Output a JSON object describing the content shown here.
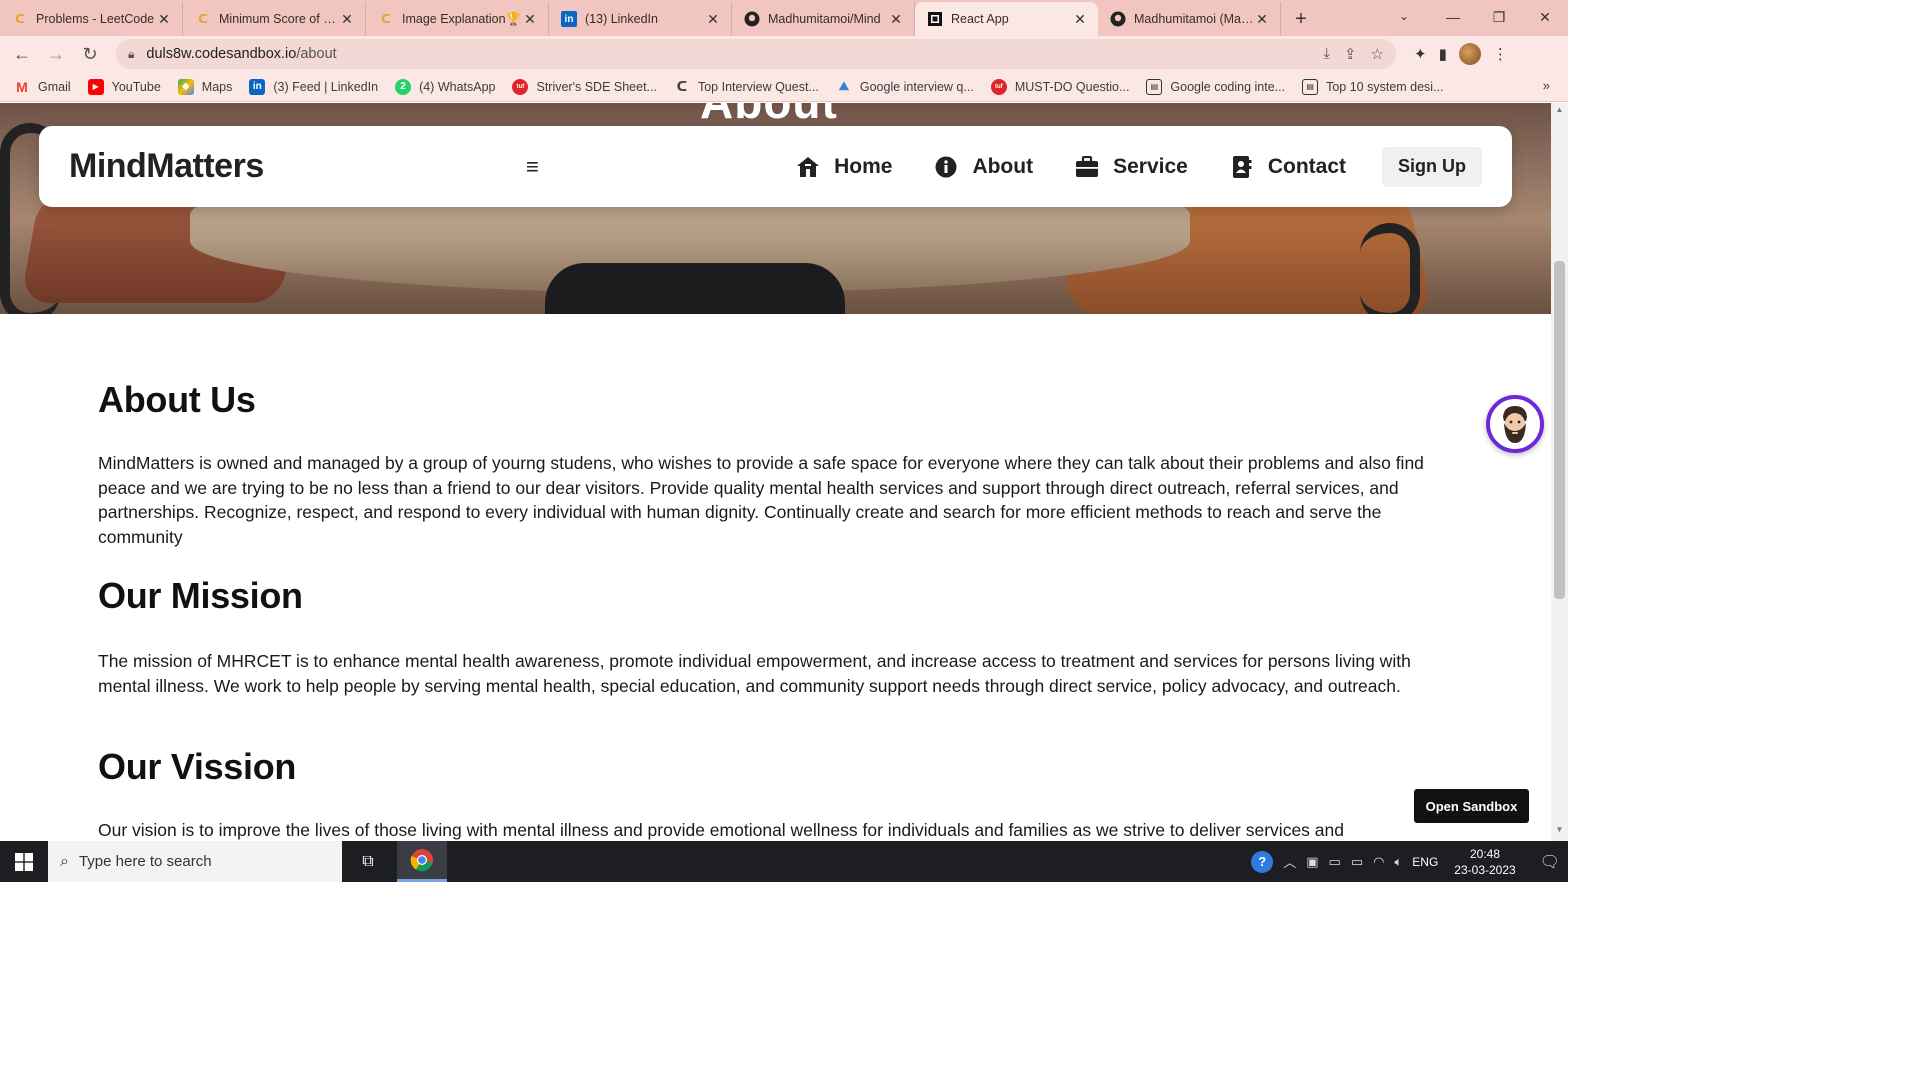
{
  "browser": {
    "tabs": [
      {
        "title": "Problems - LeetCode",
        "icon": "leetcode-icon",
        "active": false
      },
      {
        "title": "Minimum Score of a P",
        "icon": "leetcode-icon",
        "active": false
      },
      {
        "title": "Image Explanation🏆",
        "icon": "leetcode-icon",
        "active": false
      },
      {
        "title": "(13) LinkedIn",
        "icon": "linkedin-icon",
        "active": false
      },
      {
        "title": "Madhumitamoi/Mind",
        "icon": "github-icon",
        "active": false
      },
      {
        "title": "React App",
        "icon": "codesandbox-icon",
        "active": true
      },
      {
        "title": "Madhumitamoi (Madh",
        "icon": "github-icon",
        "active": false
      }
    ],
    "address": {
      "host": "duls8w.codesandbox.io",
      "path": "/about"
    },
    "bookmarks": [
      {
        "label": "Gmail",
        "icon": "gmail-icon",
        "color": "#ea4335"
      },
      {
        "label": "YouTube",
        "icon": "youtube-icon",
        "color": "#ff0000"
      },
      {
        "label": "Maps",
        "icon": "maps-icon",
        "color": "#34a853"
      },
      {
        "label": "(3) Feed | LinkedIn",
        "icon": "linkedin-icon",
        "color": "#0a66c2"
      },
      {
        "label": "(4) WhatsApp",
        "icon": "whatsapp-icon",
        "color": "#25d366"
      },
      {
        "label": "Striver's SDE Sheet...",
        "icon": "tuf-icon",
        "color": "#e0242c"
      },
      {
        "label": "Top Interview Quest...",
        "icon": "leetcode-icon",
        "color": "#444444"
      },
      {
        "label": "Google interview q...",
        "icon": "geeks-icon",
        "color": "#3b7dd8"
      },
      {
        "label": "MUST-DO Questio...",
        "icon": "tuf-icon",
        "color": "#e0242c"
      },
      {
        "label": "Google coding inte...",
        "icon": "page-icon",
        "color": "#333333"
      },
      {
        "label": "Top 10 system desi...",
        "icon": "page-icon",
        "color": "#333333"
      }
    ]
  },
  "site": {
    "hero_title": "About",
    "brand": "MindMatters",
    "nav": {
      "home": "Home",
      "about": "About",
      "service": "Service",
      "contact": "Contact",
      "signup": "Sign Up"
    },
    "sections": {
      "about_title": "About Us",
      "about_text": "MindMatters is owned and managed by a group of yourng studens, who wishes to provide a safe space for everyone where they can talk about their problems and also find peace and we are trying to be no less than a friend to our dear visitors. Provide quality mental health services and support through direct outreach, referral services, and partnerships. Recognize, respect, and respond to every individual with human dignity. Continually create and search for more efficient methods to reach and serve the community",
      "mission_title": "Our Mission",
      "mission_text": "The mission of MHRCET is to enhance mental health awareness, promote individual empowerment, and increase access to treatment and services for persons living with mental illness. We work to help people by serving mental health, special education, and community support needs through direct service, policy advocacy, and outreach.",
      "vision_title": "Our Vission",
      "vision_text": "Our vision is to improve the lives of those living with mental illness and provide emotional wellness for individuals and families as we strive to deliver services and"
    },
    "open_sandbox": "Open Sandbox"
  },
  "taskbar": {
    "search_placeholder": "Type here to search",
    "language": "ENG",
    "time": "20:48",
    "date": "23-03-2023"
  },
  "colors": {
    "tabstrip": "#f1c6c0",
    "toolbar": "#fbe7e4",
    "accent_purple": "#6d28d9",
    "taskbar": "#1c1e22"
  }
}
